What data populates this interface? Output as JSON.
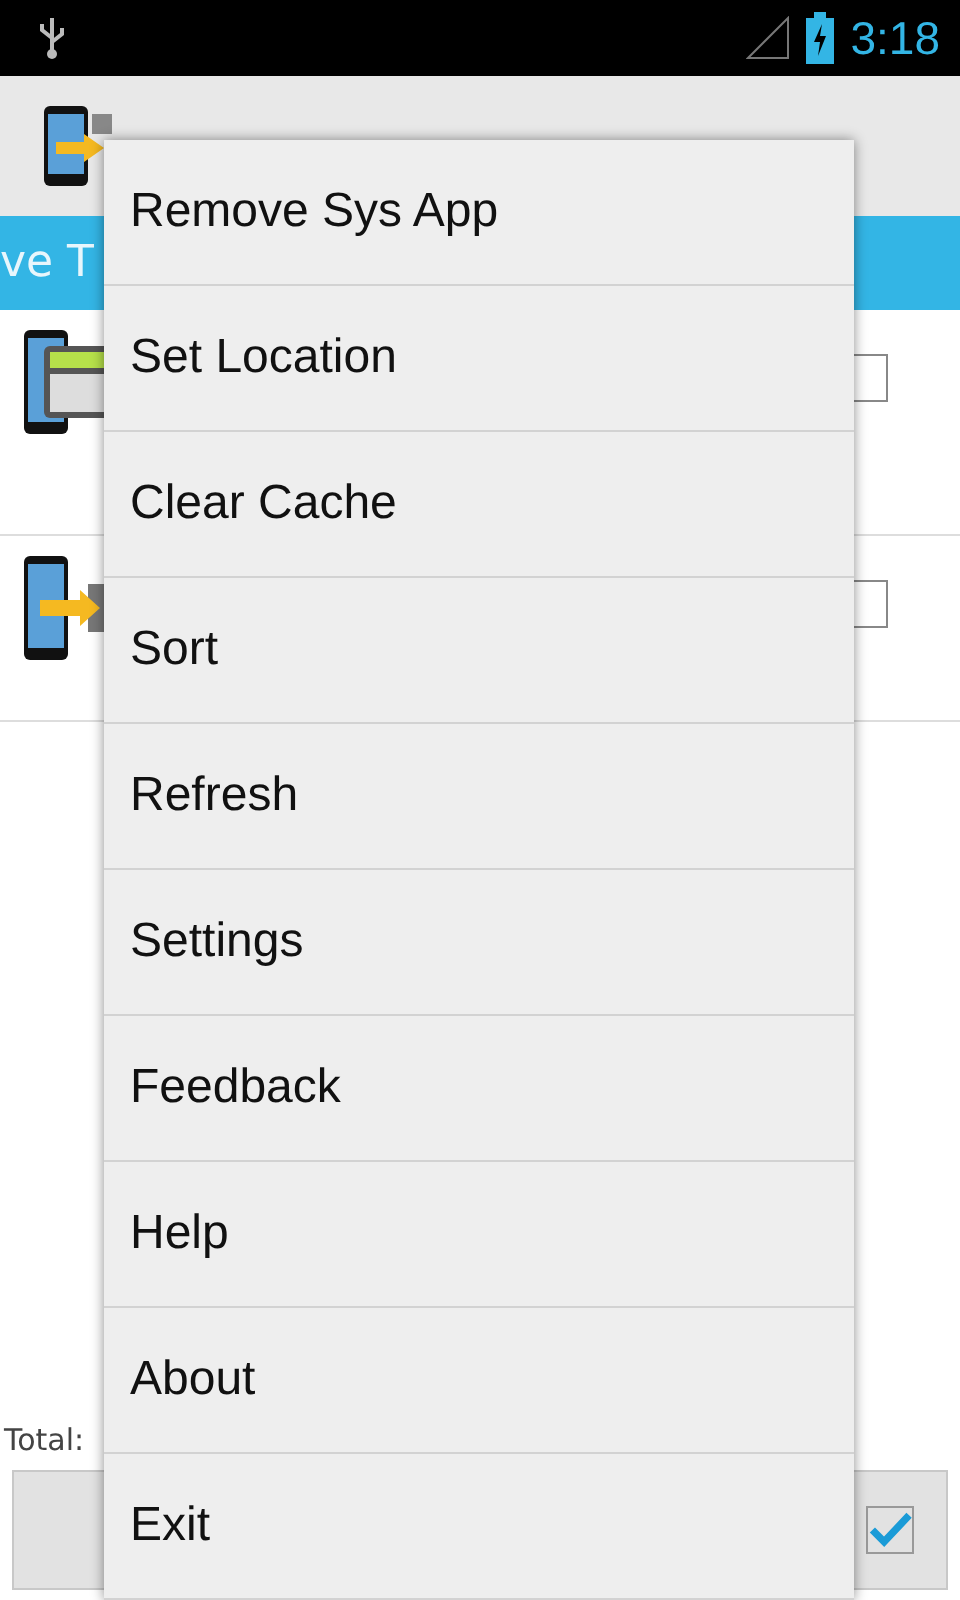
{
  "status_bar": {
    "time": "3:18"
  },
  "tab_strip": {
    "label": "ve T"
  },
  "apps": [
    {
      "kind": "lock",
      "checked": false
    },
    {
      "kind": "move",
      "checked": false
    }
  ],
  "footer": {
    "total_label": "Total:",
    "select_all_checked": true
  },
  "menu": {
    "items": [
      {
        "label": "Remove Sys App"
      },
      {
        "label": "Set Location"
      },
      {
        "label": "Clear Cache"
      },
      {
        "label": "Sort"
      },
      {
        "label": "Refresh"
      },
      {
        "label": "Settings"
      },
      {
        "label": "Feedback"
      },
      {
        "label": "Help"
      },
      {
        "label": "About"
      },
      {
        "label": "Exit"
      }
    ]
  }
}
